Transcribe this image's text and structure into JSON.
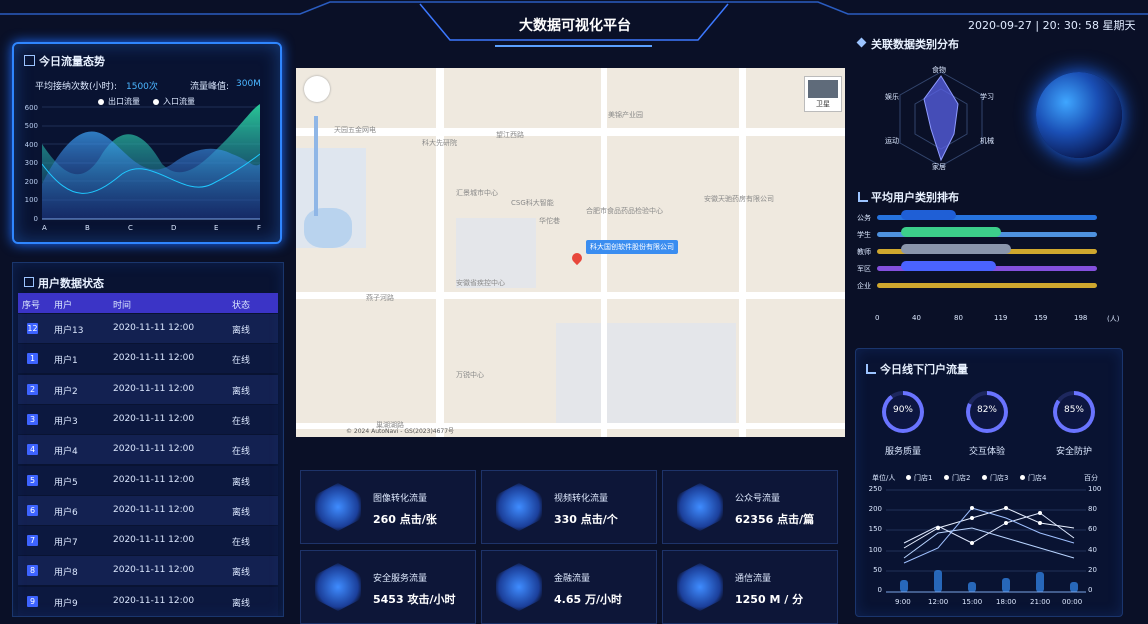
{
  "header": {
    "title": "大数据可视化平台",
    "datetime": "2020-09-27 | 20: 30: 58 星期天"
  },
  "traffic": {
    "title": "今日流量态势",
    "avg_label": "平均接纳次数(小时):",
    "avg_value": "1500次",
    "peak_label": "流量峰值:",
    "peak_value": "300M",
    "legend": [
      "出口流量",
      "入口流量"
    ],
    "ticks_y": [
      "600",
      "500",
      "400",
      "300",
      "200",
      "100",
      "0"
    ],
    "ticks_x": [
      "A",
      "B",
      "C",
      "D",
      "E",
      "F"
    ]
  },
  "users": {
    "title": "用户数据状态",
    "headers": [
      "序号",
      "用户",
      "时间",
      "状态"
    ],
    "rows": [
      {
        "no": "12",
        "user": "用户13",
        "time": "2020-11-11 12:00",
        "status": "离线"
      },
      {
        "no": "1",
        "user": "用户1",
        "time": "2020-11-11 12:00",
        "status": "在线"
      },
      {
        "no": "2",
        "user": "用户2",
        "time": "2020-11-11 12:00",
        "status": "离线"
      },
      {
        "no": "3",
        "user": "用户3",
        "time": "2020-11-11 12:00",
        "status": "在线"
      },
      {
        "no": "4",
        "user": "用户4",
        "time": "2020-11-11 12:00",
        "status": "在线"
      },
      {
        "no": "5",
        "user": "用户5",
        "time": "2020-11-11 12:00",
        "status": "离线"
      },
      {
        "no": "6",
        "user": "用户6",
        "time": "2020-11-11 12:00",
        "status": "离线"
      },
      {
        "no": "7",
        "user": "用户7",
        "time": "2020-11-11 12:00",
        "status": "在线"
      },
      {
        "no": "8",
        "user": "用户8",
        "time": "2020-11-11 12:00",
        "status": "离线"
      },
      {
        "no": "9",
        "user": "用户9",
        "time": "2020-11-11 12:00",
        "status": "离线"
      }
    ]
  },
  "map": {
    "popup": "科大国创软件股份有限公司",
    "layer_button": "卫星",
    "copyright": "© 2024 AutoNavi - GS(2023)4677号",
    "labels": [
      "科大先研院",
      "望江西路",
      "美锦产业园",
      "汇景城市中心",
      "CSG科大智能",
      "合肥市食品药品检验中心",
      "安徽省疾控中心",
      "燕子河路",
      "万锐中心",
      "巢湖湖路",
      "天园五金网电",
      "华佗巷",
      "安徽天驰药房有限公司"
    ]
  },
  "radar": {
    "title": "关联数据类别分布",
    "labels": [
      "食物",
      "学习",
      "机械",
      "家居",
      "运动",
      "娱乐"
    ]
  },
  "ranking": {
    "title": "平均用户类别排布",
    "categories": [
      "公务",
      "学生",
      "教师",
      "军区",
      "企业"
    ],
    "ticks": [
      "0",
      "40",
      "80",
      "119",
      "159",
      "198"
    ],
    "unit": "(人)"
  },
  "offline": {
    "title": "今日线下门户流量",
    "rings": [
      {
        "value": "90%",
        "label": "服务质量"
      },
      {
        "value": "82%",
        "label": "交互体验"
      },
      {
        "value": "85%",
        "label": "安全防护"
      }
    ],
    "unit": "单位/人",
    "legend": [
      "门店1",
      "门店2",
      "门店3",
      "门店4"
    ],
    "right_label": "百分",
    "y_left": [
      "250",
      "200",
      "150",
      "100",
      "50",
      "0"
    ],
    "y_right": [
      "100",
      "80",
      "60",
      "40",
      "20",
      "0"
    ],
    "x": [
      "9:00",
      "12:00",
      "15:00",
      "18:00",
      "21:00",
      "00:00"
    ]
  },
  "cards": [
    {
      "title": "图像转化流量",
      "value": "260  点击/张"
    },
    {
      "title": "视频转化流量",
      "value": "330  点击/个"
    },
    {
      "title": "公众号流量",
      "value": "62356  点击/篇"
    },
    {
      "title": "安全服务流量",
      "value": "5453  攻击/小时"
    },
    {
      "title": "金融流量",
      "value": "4.65  万/小时"
    },
    {
      "title": "通信流量",
      "value": "1250  M / 分"
    }
  ],
  "colors": {
    "accent": "#2f86ff",
    "bg": "#0a1027",
    "purple": "#3a34c9",
    "yellow": "#f2c230"
  }
}
